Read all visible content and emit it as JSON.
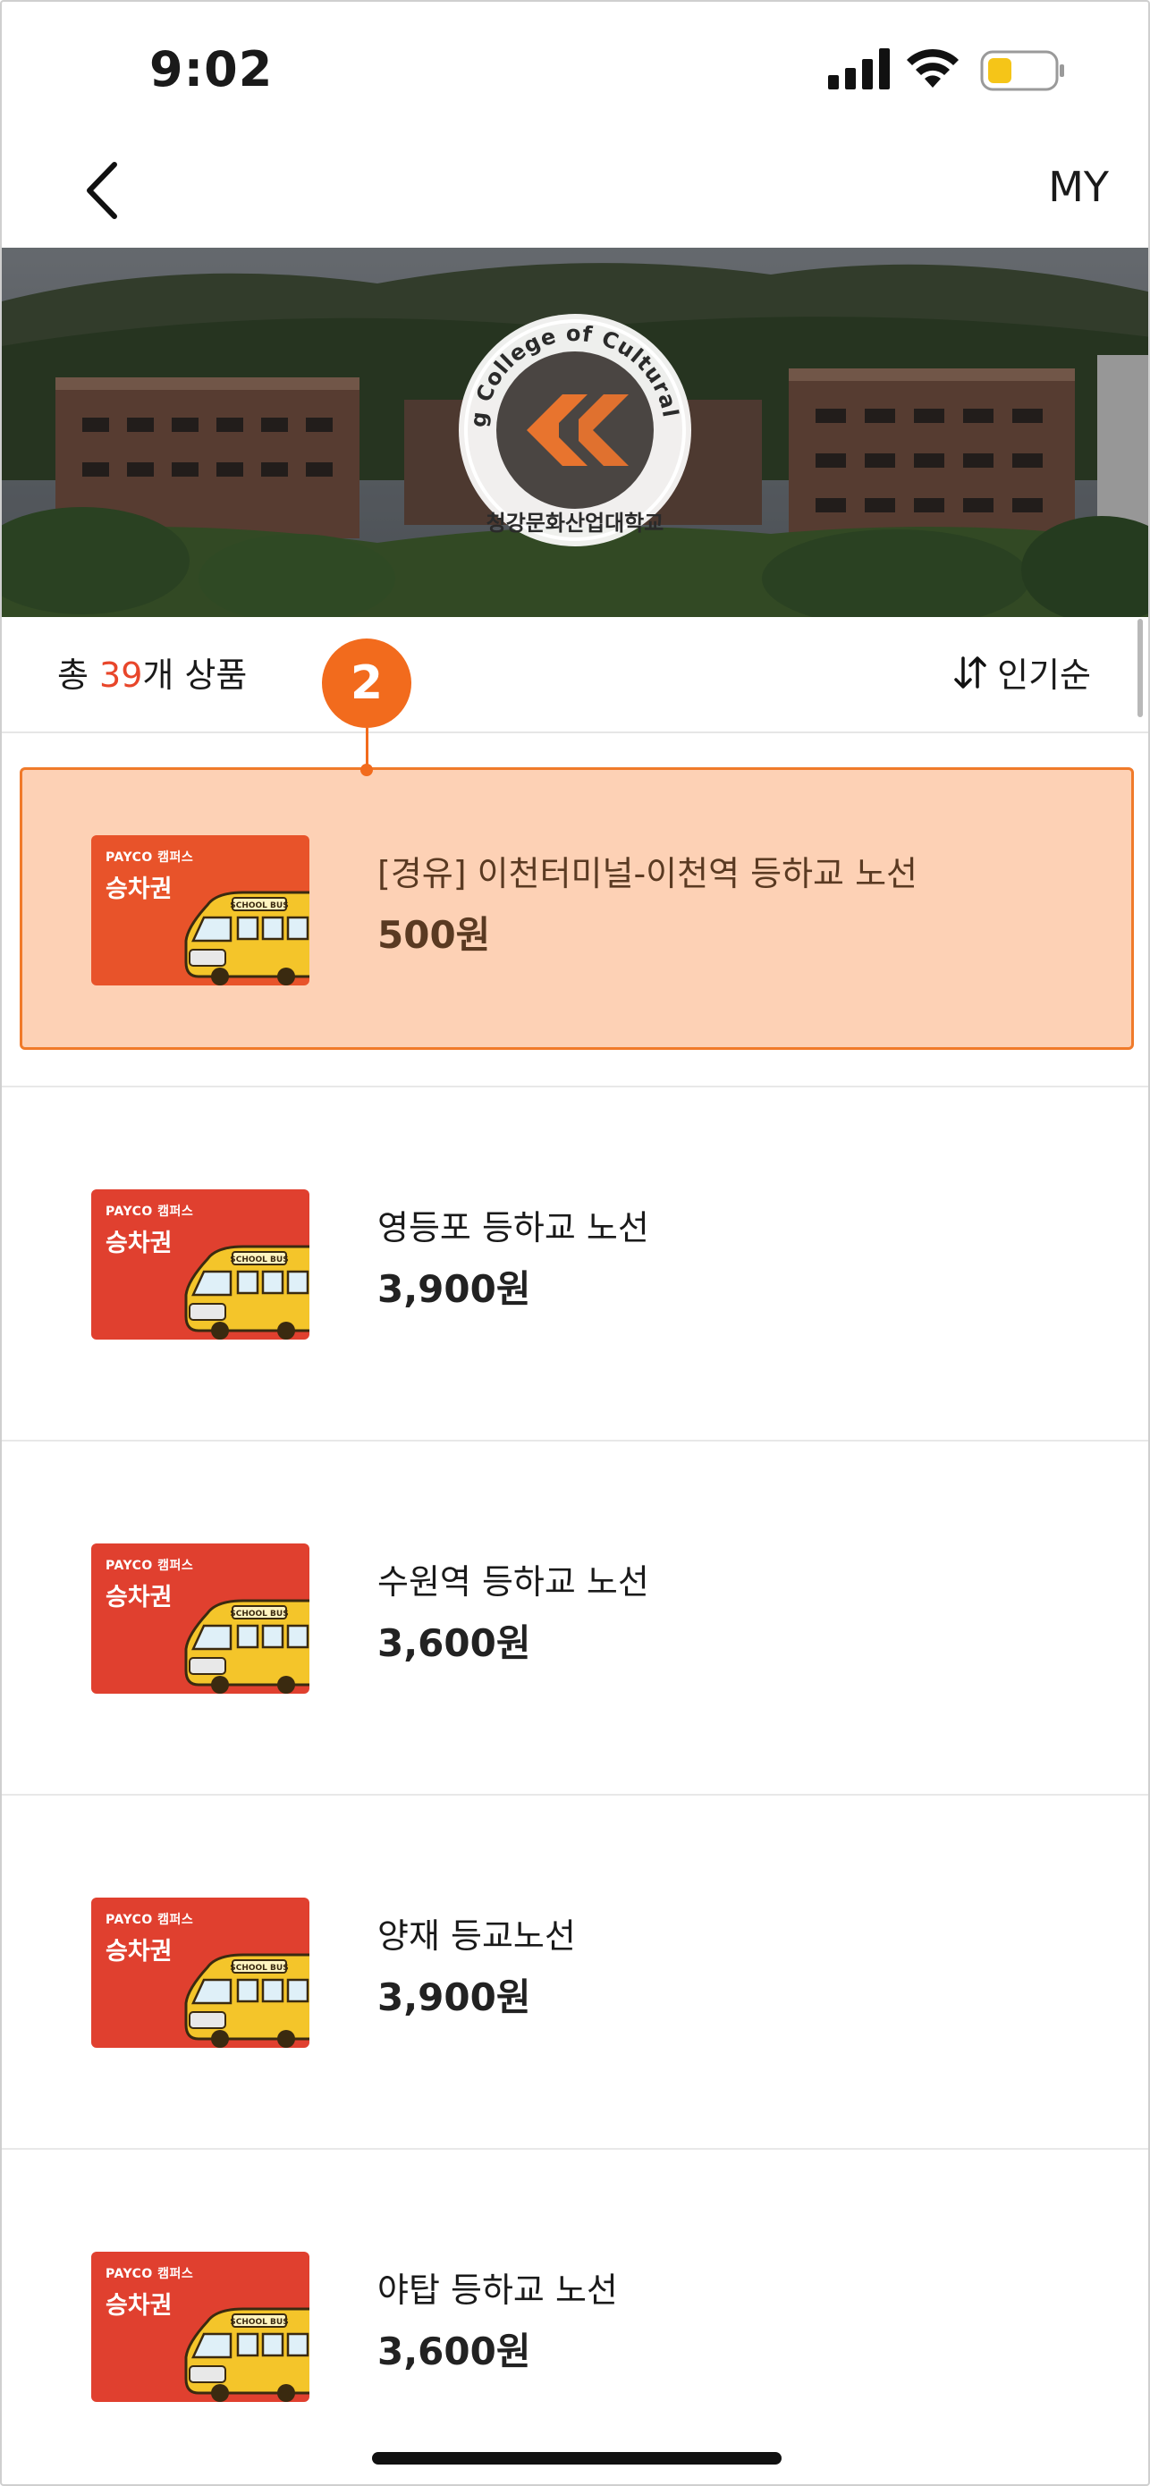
{
  "status_bar": {
    "time": "9:02"
  },
  "nav": {
    "my_label": "MY"
  },
  "banner": {
    "logo_arc_text": "ChungKang College of Cultural Industries",
    "logo_bottom_text": "청강문화산업대학교",
    "logo_mark": "CK",
    "accent": "#e8742e"
  },
  "list_header": {
    "count_prefix": "총 ",
    "count_value": "39",
    "count_suffix": "개 상품",
    "sort_label": "인기순",
    "count_color": "#e8462a"
  },
  "step_marker": "2",
  "ticket_card": {
    "sub_label": "PAYCO 캠퍼스",
    "title": "승차권",
    "bus_sign": "SCHOOL BUS"
  },
  "items": [
    {
      "name": "[경유] 이천터미널-이천역 등하교 노선",
      "price": "500원",
      "highlighted": true
    },
    {
      "name": "영등포 등하교 노선",
      "price": "3,900원",
      "highlighted": false
    },
    {
      "name": "수원역 등하교 노선",
      "price": "3,600원",
      "highlighted": false
    },
    {
      "name": "양재 등교노선",
      "price": "3,900원",
      "highlighted": false
    },
    {
      "name": "야탑 등하교 노선",
      "price": "3,600원",
      "highlighted": false
    }
  ],
  "colors": {
    "highlight_bg": "#fdd1b5",
    "highlight_border": "#f07a2a",
    "ticket_red": "#e0402f",
    "ticket_orange": "#e8532a",
    "marker": "#f26b1d"
  }
}
